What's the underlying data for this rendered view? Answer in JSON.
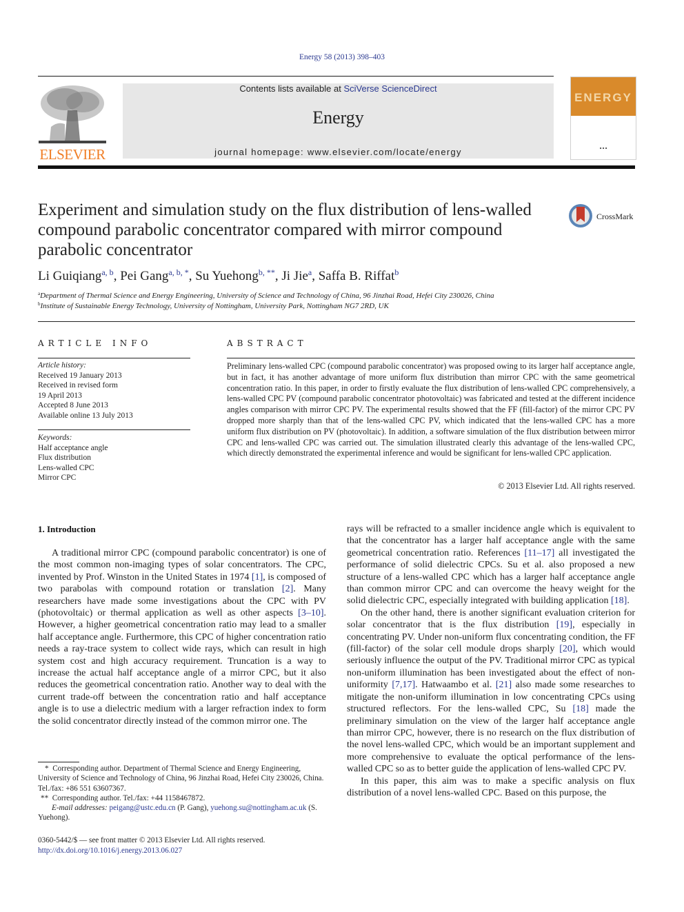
{
  "header": {
    "journal_ref": "Energy 58 (2013) 398–403",
    "contents_prefix": "Contents lists available at ",
    "contents_link": "SciVerse ScienceDirect",
    "journal_name": "Energy",
    "homepage": "journal homepage: www.elsevier.com/locate/energy",
    "publisher_logo_text": "ELSEVIER",
    "cover_title": "ENERGY",
    "crossmark_label": "CrossMark"
  },
  "colors": {
    "link": "#2b3990",
    "elsevier_orange": "#f07e26",
    "masthead_gray": "#e7e7e7",
    "cover_orange": "#d98a2b"
  },
  "article": {
    "title": "Experiment and simulation study on the flux distribution of lens-walled compound parabolic concentrator compared with mirror compound parabolic concentrator",
    "authors": [
      {
        "name": "Li Guiqiang",
        "sup": "a, b"
      },
      {
        "name": "Pei Gang",
        "sup": "a, b, *"
      },
      {
        "name": "Su Yuehong",
        "sup": "b, **"
      },
      {
        "name": "Ji Jie",
        "sup": "a"
      },
      {
        "name": "Saffa B. Riffat",
        "sup": "b"
      }
    ],
    "affiliations": [
      {
        "key": "a",
        "text": "Department of Thermal Science and Energy Engineering, University of Science and Technology of China, 96 Jinzhai Road, Hefei City 230026, China"
      },
      {
        "key": "b",
        "text": "Institute of Sustainable Energy Technology, University of Nottingham, University Park, Nottingham NG7 2RD, UK"
      }
    ]
  },
  "article_info": {
    "heading": "ARTICLE INFO",
    "history_label": "Article history:",
    "history": [
      "Received 19 January 2013",
      "Received in revised form",
      "19 April 2013",
      "Accepted 8 June 2013",
      "Available online 13 July 2013"
    ],
    "keywords_label": "Keywords:",
    "keywords": [
      "Half acceptance angle",
      "Flux distribution",
      "Lens-walled CPC",
      "Mirror CPC"
    ]
  },
  "abstract": {
    "heading": "ABSTRACT",
    "text": "Preliminary lens-walled CPC (compound parabolic concentrator) was proposed owing to its larger half acceptance angle, but in fact, it has another advantage of more uniform flux distribution than mirror CPC with the same geometrical concentration ratio. In this paper, in order to firstly evaluate the flux distribution of lens-walled CPC comprehensively, a lens-walled CPC PV (compound parabolic concentrator photovoltaic) was fabricated and tested at the different incidence angles comparison with mirror CPC PV. The experimental results showed that the FF (fill-factor) of the mirror CPC PV dropped more sharply than that of the lens-walled CPC PV, which indicated that the lens-walled CPC has a more uniform flux distribution on PV (photovoltaic). In addition, a software simulation of the flux distribution between mirror CPC and lens-walled CPC was carried out. The simulation illustrated clearly this advantage of the lens-walled CPC, which directly demonstrated the experimental inference and would be significant for lens-walled CPC application.",
    "copyright": "© 2013 Elsevier Ltd. All rights reserved."
  },
  "body": {
    "section_heading": "1.  Introduction",
    "left_paragraph": [
      {
        "t": "A traditional mirror CPC (compound parabolic concentrator) is one of the most common non-imaging types of solar concentrators. The CPC, invented by Prof. Winston in the United States in 1974 "
      },
      {
        "r": "[1]"
      },
      {
        "t": ", is composed of two parabolas with compound rotation or translation "
      },
      {
        "r": "[2]"
      },
      {
        "t": ". Many researchers have made some investigations about the CPC with PV (photovoltaic) or thermal application as well as other aspects "
      },
      {
        "r": "[3–10]"
      },
      {
        "t": ". However, a higher geometrical concentration ratio may lead to a smaller half acceptance angle. Furthermore, this CPC of higher concentration ratio needs a ray-trace system to collect wide rays, which can result in high system cost and high accuracy requirement. Truncation is a way to increase the actual half acceptance angle of a mirror CPC, but it also reduces the geometrical concentration ratio. Another way to deal with the current trade-off between the concentration ratio and half acceptance angle is to use a dielectric medium with a larger refraction index to form the solid concentrator directly instead of the common mirror one. The"
      }
    ],
    "right_paragraphs": [
      [
        {
          "t": "rays will be refracted to a smaller incidence angle which is equivalent to that the concentrator has a larger half acceptance angle with the same geometrical concentration ratio. References "
        },
        {
          "r": "[11–17]"
        },
        {
          "t": " all investigated the performance of solid dielectric CPCs. Su et al. also proposed a new structure of a lens-walled CPC which has a larger half acceptance angle than common mirror CPC and can overcome the heavy weight for the solid dielectric CPC, especially integrated with building application "
        },
        {
          "r": "[18]"
        },
        {
          "t": "."
        }
      ],
      [
        {
          "t": "On the other hand, there is another significant evaluation criterion for solar concentrator that is the flux distribution "
        },
        {
          "r": "[19]"
        },
        {
          "t": ", especially in concentrating PV. Under non-uniform flux concentrating condition, the FF (fill-factor) of the solar cell module drops sharply "
        },
        {
          "r": "[20]"
        },
        {
          "t": ", which would seriously influence the output of the PV. Traditional mirror CPC as typical non-uniform illumination has been investigated about the effect of non-uniformity "
        },
        {
          "r": "[7,17]"
        },
        {
          "t": ". Hatwaambo et al. "
        },
        {
          "r": "[21]"
        },
        {
          "t": " also made some researches to mitigate the non-uniform illumination in low concentrating CPCs using structured reflectors. For the lens-walled CPC, Su "
        },
        {
          "r": "[18]"
        },
        {
          "t": " made the preliminary simulation on the view of the larger half acceptance angle than mirror CPC, however, there is no research on the flux distribution of the novel lens-walled CPC, which would be an important supplement and more comprehensive to evaluate the optical performance of the lens-walled CPC so as to better guide the application of lens-walled CPC PV."
        }
      ],
      [
        {
          "t": "In this paper, this aim was to make a specific analysis on flux distribution of a novel lens-walled CPC. Based on this purpose, the"
        }
      ]
    ]
  },
  "footnotes": {
    "star1_mark": "*",
    "star1": "Corresponding author. Department of Thermal Science and Energy Engineering, University of Science and Technology of China, 96 Jinzhai Road, Hefei City 230026, China. Tel./fax: +86 551 63607367.",
    "star2_mark": "**",
    "star2": "Corresponding author. Tel./fax: +44 1158467872.",
    "email_label": "E-mail addresses:",
    "email1": "peigang@ustc.edu.cn",
    "email1_name": " (P. Gang), ",
    "email2": "yuehong.su@nottingham.ac.uk",
    "email2_name": "(S. Yuehong).",
    "issn_line": "0360-5442/$ — see front matter © 2013 Elsevier Ltd. All rights reserved.",
    "doi": "http://dx.doi.org/10.1016/j.energy.2013.06.027"
  }
}
